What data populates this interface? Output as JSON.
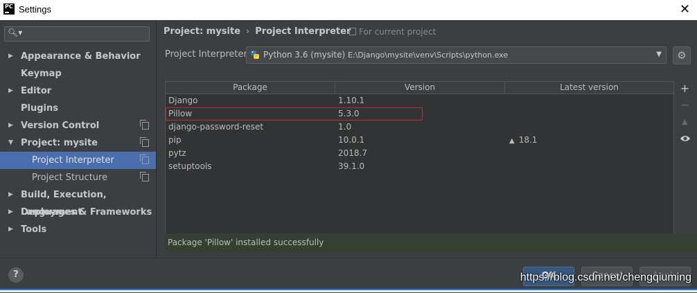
{
  "window": {
    "title": "Settings",
    "logo_text": "PC"
  },
  "sidebar": {
    "search_placeholder": "",
    "items": [
      {
        "label": "Appearance & Behavior"
      },
      {
        "label": "Keymap"
      },
      {
        "label": "Editor"
      },
      {
        "label": "Plugins"
      },
      {
        "label": "Version Control"
      },
      {
        "label": "Project: mysite"
      },
      {
        "label": "Project Interpreter"
      },
      {
        "label": "Project Structure"
      },
      {
        "label": "Build, Execution, Deployment"
      },
      {
        "label": "Languages & Frameworks"
      },
      {
        "label": "Tools"
      }
    ]
  },
  "breadcrumb": {
    "parent": "Project: mysite",
    "separator": "›",
    "current": "Project Interpreter",
    "scope": "For current project"
  },
  "interpreter": {
    "label": "Project Interpreter:",
    "name": "Python 3.6 (mysite)",
    "path": "E:\\Django\\mysite\\venv\\Scripts\\python.exe"
  },
  "packages": {
    "headers": [
      "Package",
      "Version",
      "Latest version"
    ],
    "rows": [
      {
        "package": "Django",
        "version": "1.10.1",
        "latest": ""
      },
      {
        "package": "Pillow",
        "version": "5.3.0",
        "latest": ""
      },
      {
        "package": "django-password-reset",
        "version": "1.0",
        "latest": ""
      },
      {
        "package": "pip",
        "version": "10.0.1",
        "latest": "18.1"
      },
      {
        "package": "pytz",
        "version": "2018.7",
        "latest": ""
      },
      {
        "package": "setuptools",
        "version": "39.1.0",
        "latest": ""
      }
    ]
  },
  "status": {
    "message": "Package 'Pillow' installed successfully"
  },
  "footer": {
    "help": "?",
    "ok": "OK",
    "cancel": "Cancel",
    "apply": "Apply"
  },
  "watermark": "https://blog.csdn.net/chengqiuming",
  "colors": {
    "selection": "#4b6eaf",
    "highlight_border": "#c62828",
    "status_bg": "#354033",
    "ok_button": "#365880"
  }
}
